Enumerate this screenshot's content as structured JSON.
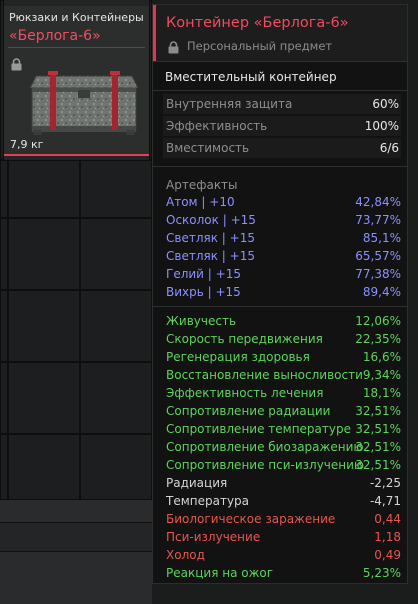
{
  "inventory": {
    "card": {
      "category": "Рюкзаки и Контейнеры",
      "name": "«Берлога-6»",
      "weight": "7,9 кг",
      "lock_icon": "lock-icon",
      "image_icon": "container-box-icon"
    }
  },
  "tooltip": {
    "title": "Контейнер «Берлога-6»",
    "subtitle": "Персональный предмет",
    "lock_icon": "lock-icon",
    "description": "Вместительный контейнер",
    "stats": [
      {
        "label": "Внутренняя защита",
        "value": "60%"
      },
      {
        "label": "Эффективность",
        "value": "100%"
      },
      {
        "label": "Вместимость",
        "value": "6/6"
      }
    ],
    "artifacts_label": "Артефакты",
    "artifacts": [
      {
        "label": "Атом | +10",
        "value": "42,84%"
      },
      {
        "label": "Осколок | +15",
        "value": "73,77%"
      },
      {
        "label": "Светляк | +15",
        "value": "85,1%"
      },
      {
        "label": "Светляк | +15",
        "value": "65,57%"
      },
      {
        "label": "Гелий | +15",
        "value": "77,38%"
      },
      {
        "label": "Вихрь | +15",
        "value": "89,4%"
      }
    ],
    "effects": [
      {
        "label": "Живучесть",
        "value": "12,06%",
        "tone": "pos"
      },
      {
        "label": "Скорость передвижения",
        "value": "22,35%",
        "tone": "pos"
      },
      {
        "label": "Регенерация здоровья",
        "value": "16,6%",
        "tone": "pos"
      },
      {
        "label": "Восстановление выносливости",
        "value": "9,34%",
        "tone": "pos"
      },
      {
        "label": "Эффективность лечения",
        "value": "18,1%",
        "tone": "pos"
      },
      {
        "label": "Сопротивление радиации",
        "value": "32,51%",
        "tone": "pos"
      },
      {
        "label": "Сопротивление температуре",
        "value": "32,51%",
        "tone": "pos"
      },
      {
        "label": "Сопротивление биозаражению",
        "value": "32,51%",
        "tone": "pos"
      },
      {
        "label": "Сопротивление пси-излучению",
        "value": "32,51%",
        "tone": "pos"
      },
      {
        "label": "Радиация",
        "value": "-2,25",
        "tone": "neu"
      },
      {
        "label": "Температура",
        "value": "-4,71",
        "tone": "neu"
      },
      {
        "label": "Биологическое заражение",
        "value": "0,44",
        "tone": "neg"
      },
      {
        "label": "Пси-излучение",
        "value": "1,18",
        "tone": "neg"
      },
      {
        "label": "Холод",
        "value": "0,49",
        "tone": "neg"
      },
      {
        "label": "Реакция на ожог",
        "value": "5,23%",
        "tone": "pos"
      }
    ]
  },
  "colors": {
    "accent_red": "#e23650",
    "artifact_blue": "#8c90ff",
    "positive_green": "#5bd45a",
    "negative_red": "#e8544e"
  }
}
